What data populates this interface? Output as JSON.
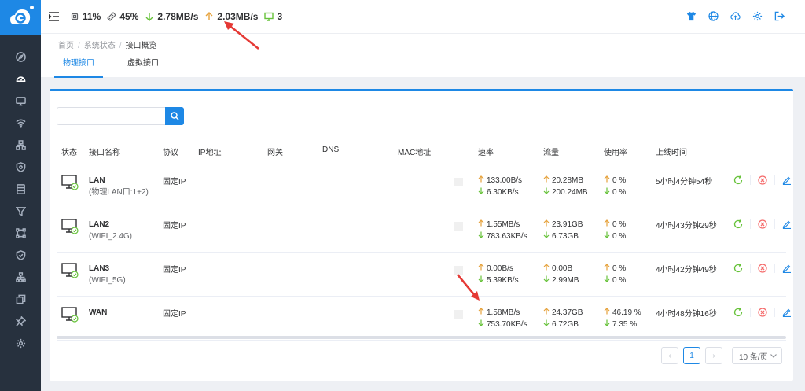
{
  "topbar": {
    "cpu": "11%",
    "mem": "45%",
    "down": "2.78MB/s",
    "up": "2.03MB/s",
    "clients": "3"
  },
  "breadcrumb": [
    "首页",
    "系统状态",
    "接口概览"
  ],
  "tabs": [
    "物理接口",
    "虚拟接口"
  ],
  "search": {
    "value": ""
  },
  "columns": [
    "状态",
    "接口名称",
    "协议",
    "IP地址",
    "网关",
    "DNS",
    "MAC地址",
    "速率",
    "流量",
    "使用率",
    "上线时间"
  ],
  "rows": [
    {
      "name": "LAN",
      "sub": "(物理LAN口:1+2)",
      "proto": "固定IP",
      "rate_up": "133.00B/s",
      "rate_down": "6.30KB/s",
      "flow_up": "20.28MB",
      "flow_down": "200.24MB",
      "use_up": "0 %",
      "use_down": "0 %",
      "time": "5小时4分钟54秒"
    },
    {
      "name": "LAN2",
      "sub": "(WIFI_2.4G)",
      "proto": "固定IP",
      "rate_up": "1.55MB/s",
      "rate_down": "783.63KB/s",
      "flow_up": "23.91GB",
      "flow_down": "6.73GB",
      "use_up": "0 %",
      "use_down": "0 %",
      "time": "4小时43分钟29秒"
    },
    {
      "name": "LAN3",
      "sub": "(WIFI_5G)",
      "proto": "固定IP",
      "rate_up": "0.00B/s",
      "rate_down": "5.39KB/s",
      "flow_up": "0.00B",
      "flow_down": "2.99MB",
      "use_up": "0 %",
      "use_down": "0 %",
      "time": "4小时42分钟49秒"
    },
    {
      "name": "WAN",
      "sub": "",
      "proto": "固定IP",
      "rate_up": "1.58MB/s",
      "rate_down": "753.70KB/s",
      "flow_up": "24.37GB",
      "flow_down": "6.72GB",
      "use_up": "46.19 %",
      "use_down": "7.35 %",
      "time": "4小时48分钟16秒"
    }
  ],
  "pager": {
    "current": "1",
    "size": "10 条/页"
  },
  "colors": {
    "accent": "#1e88e5",
    "up": "#e6a23c",
    "down": "#67c23a",
    "danger": "#f56c6c",
    "annotation": "#e53935"
  }
}
